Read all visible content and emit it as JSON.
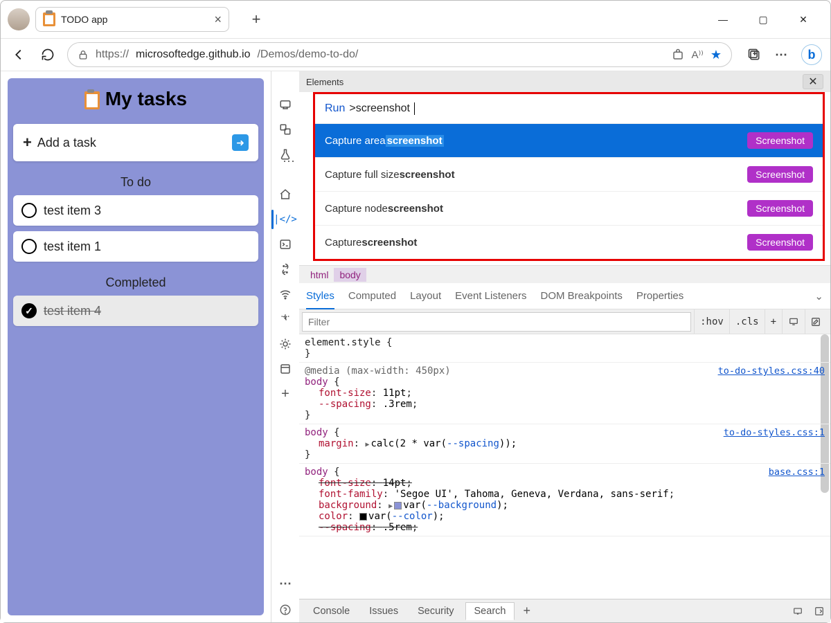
{
  "window": {
    "tab_title": "TODO app"
  },
  "url": {
    "grey_pre": "https://",
    "host": "microsoftedge.github.io",
    "path_grey": "/Demos/demo-to-do/"
  },
  "app": {
    "title": "My tasks",
    "add_label": "Add a task",
    "todo_header": "To do",
    "completed_header": "Completed",
    "todo_items": [
      "test item 3",
      "test item 1"
    ],
    "done_items": [
      "test item 4"
    ]
  },
  "devtools": {
    "top_label": "Elements",
    "cmd_run": "Run",
    "cmd_query": ">screenshot",
    "badge": "Screenshot",
    "cmds": [
      {
        "pre": "Capture area ",
        "hl": "screenshot",
        "sel": true
      },
      {
        "pre": "Capture full size ",
        "hl": "screenshot"
      },
      {
        "pre": "Capture node ",
        "hl": "screenshot"
      },
      {
        "pre": "Capture ",
        "hl": "screenshot"
      }
    ],
    "breadcrumbs": [
      "html",
      "body"
    ],
    "styletabs": [
      "Styles",
      "Computed",
      "Layout",
      "Event Listeners",
      "DOM Breakpoints",
      "Properties"
    ],
    "filter_placeholder": "Filter",
    "hov": ":hov",
    "cls": ".cls",
    "rules": {
      "r0": "element.style {",
      "rmedia": "@media (max-width: 450px)",
      "link1": "to-do-styles.css:40",
      "link2": "to-do-styles.css:1",
      "link3": "base.css:1",
      "body_sel": "body",
      "fs11": "font-size: 11pt;",
      "sp3": "--spacing: .3rem;",
      "margin_calc": "calc(2 * var(",
      "margin_var": "--spacing",
      "margin_tail": "));",
      "fs14": "font-size: 14pt;",
      "ff": "font-family: 'Segoe UI', Tahoma, Geneva, Verdana, sans-serif;",
      "bg": "background:",
      "bgvar": "--background",
      "col": "color:",
      "colvar": "--color",
      "sp5": "--spacing: .5rem;"
    },
    "bottom_tabs": [
      "Console",
      "Issues",
      "Security",
      "Search"
    ]
  }
}
